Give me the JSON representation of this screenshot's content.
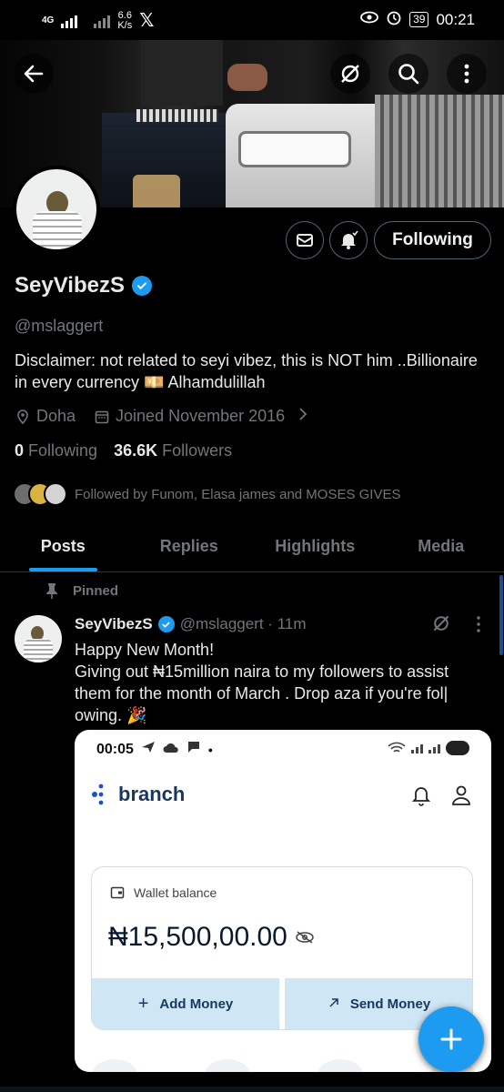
{
  "status_bar": {
    "network_label": "4G",
    "speed_value": "6.6",
    "speed_unit": "K/s",
    "battery": "39",
    "time": "00:21"
  },
  "header": {
    "back_icon": "arrow-left-icon",
    "grok_icon": "grok-icon",
    "search_icon": "search-icon",
    "more_icon": "more-vertical-icon"
  },
  "profile": {
    "name": "SeyVibezS",
    "handle": "@mslaggert",
    "bio": "Disclaimer: not related to seyi vibez, this is NOT him ..Billionaire in every currency 💴 Alhamdulillah",
    "location": "Doha",
    "joined": "Joined November 2016",
    "following_count": "0",
    "following_label": "Following",
    "followers_count": "36.6K",
    "followers_label": "Followers",
    "followed_by": "Followed by Funom, Elasa james and MOSES GIVES",
    "following_button": "Following"
  },
  "tabs": [
    "Posts",
    "Replies",
    "Highlights",
    "Media"
  ],
  "post": {
    "pinned_label": "Pinned",
    "name": "SeyVibezS",
    "handle_time": "@mslaggert · 11m",
    "text": "Happy New Month!\nGiving out ₦15million naira to my followers to assist them for the month of March . Drop aza if you're fol| owing. 🎉"
  },
  "embed": {
    "time": "00:05",
    "brand": "branch",
    "wallet_label": "Wallet balance",
    "amount": "₦15,500,00.00",
    "add_money": "Add Money",
    "send_money": "Send Money"
  },
  "colors": {
    "accent": "#1d9bf0",
    "background": "#000000",
    "muted_text": "#71767b"
  }
}
